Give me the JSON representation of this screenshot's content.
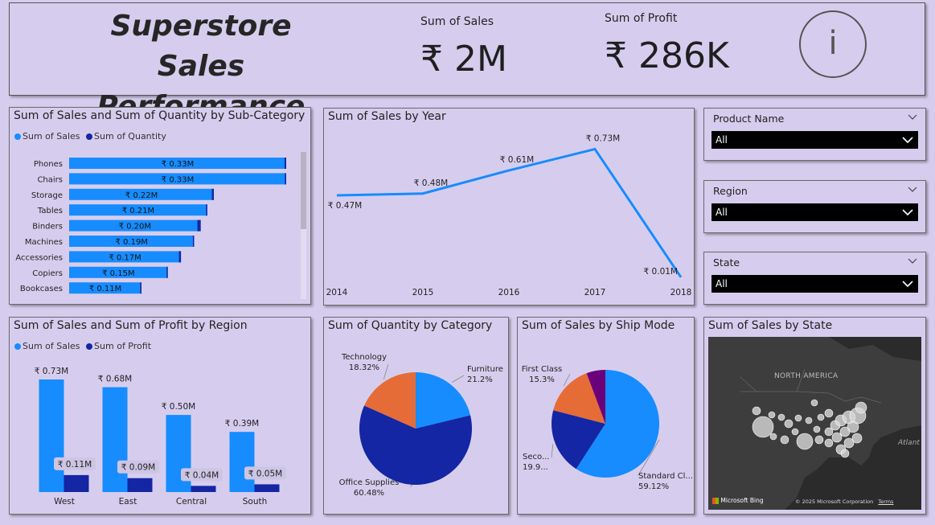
{
  "header": {
    "title_line1": "Superstore Sales",
    "title_line2": "Performance",
    "kpi_sales_label": "Sum of Sales",
    "kpi_sales_value": "₹ 2M",
    "kpi_profit_label": "Sum of Profit",
    "kpi_profit_value": "₹ 286K",
    "info_glyph": "i",
    "info_icon": "info-icon"
  },
  "colors": {
    "sales": "#168cff",
    "second": "#1426a3",
    "orange": "#e66c37",
    "purple": "#6b007b",
    "bg": "#d6cdee"
  },
  "slicers": [
    {
      "label": "Product Name",
      "value": "All"
    },
    {
      "label": "Region",
      "value": "All"
    },
    {
      "label": "State",
      "value": "All"
    }
  ],
  "map": {
    "title": "Sum of Sales by State",
    "label_continent": "NORTH AMERICA",
    "label_ocean": "Atlant",
    "brand": "Microsoft Bing",
    "copyright": "© 2025 Microsoft Corporation",
    "terms": "Terms"
  },
  "chart_data": [
    {
      "id": "subcat",
      "type": "bar",
      "title": "Sum of Sales and Sum of Quantity by Sub-Category",
      "legend": [
        "Sum of Sales",
        "Sum of Quantity"
      ],
      "categories": [
        "Phones",
        "Chairs",
        "Storage",
        "Tables",
        "Binders",
        "Machines",
        "Accessories",
        "Copiers",
        "Bookcases"
      ],
      "series": [
        {
          "name": "Sum of Sales",
          "values": [
            0.33,
            0.33,
            0.22,
            0.21,
            0.2,
            0.19,
            0.17,
            0.15,
            0.11
          ],
          "labels": [
            "₹ 0.33M",
            "₹ 0.33M",
            "₹ 0.22M",
            "₹ 0.21M",
            "₹ 0.20M",
            "₹ 0.19M",
            "₹ 0.17M",
            "₹ 0.15M",
            "₹ 0.11M"
          ]
        },
        {
          "name": "Sum of Quantity",
          "values": [
            0.0025,
            0.002,
            0.003,
            0.001,
            0.005,
            0.0004,
            0.003,
            0.0002,
            0.0008
          ]
        }
      ]
    },
    {
      "id": "year",
      "type": "line",
      "title": "Sum of Sales by Year",
      "x": [
        "2014",
        "2015",
        "2016",
        "2017",
        "2018"
      ],
      "values": [
        0.47,
        0.48,
        0.61,
        0.73,
        0.01
      ],
      "labels": [
        "₹ 0.47M",
        "₹ 0.48M",
        "₹ 0.61M",
        "₹ 0.73M",
        "₹ 0.01M"
      ]
    },
    {
      "id": "region",
      "type": "bar",
      "title": "Sum of Sales and Sum of Profit by Region",
      "legend": [
        "Sum of Sales",
        "Sum of Profit"
      ],
      "categories": [
        "West",
        "East",
        "Central",
        "South"
      ],
      "series": [
        {
          "name": "Sum of Sales",
          "values": [
            0.73,
            0.68,
            0.5,
            0.39
          ],
          "labels": [
            "₹ 0.73M",
            "₹ 0.68M",
            "₹ 0.50M",
            "₹ 0.39M"
          ]
        },
        {
          "name": "Sum of Profit",
          "values": [
            0.11,
            0.09,
            0.04,
            0.05
          ],
          "labels": [
            "₹ 0.11M",
            "₹ 0.09M",
            "₹ 0.04M",
            "₹ 0.05M"
          ]
        }
      ]
    },
    {
      "id": "category",
      "type": "pie",
      "title": "Sum of Quantity by Category",
      "slices": [
        {
          "label": "Furniture",
          "pct_label": "21.2%",
          "value": 21.2,
          "color": "#168cff"
        },
        {
          "label": "Office Supplies",
          "pct_label": "60.48%",
          "value": 60.48,
          "color": "#1426a3"
        },
        {
          "label": "Technology",
          "pct_label": "18.32%",
          "value": 18.32,
          "color": "#e66c37"
        }
      ]
    },
    {
      "id": "shipmode",
      "type": "pie",
      "title": "Sum of Sales by Ship Mode",
      "slices": [
        {
          "label": "Standard Cl...",
          "pct_label": "59.12%",
          "value": 59.12,
          "color": "#168cff"
        },
        {
          "label": "Seco...",
          "pct_label": "19.9...",
          "value": 19.9,
          "color": "#1426a3"
        },
        {
          "label": "First Class",
          "pct_label": "15.3%",
          "value": 15.3,
          "color": "#e66c37"
        },
        {
          "label": "",
          "pct_label": "",
          "value": 5.68,
          "color": "#6b007b"
        }
      ]
    }
  ]
}
